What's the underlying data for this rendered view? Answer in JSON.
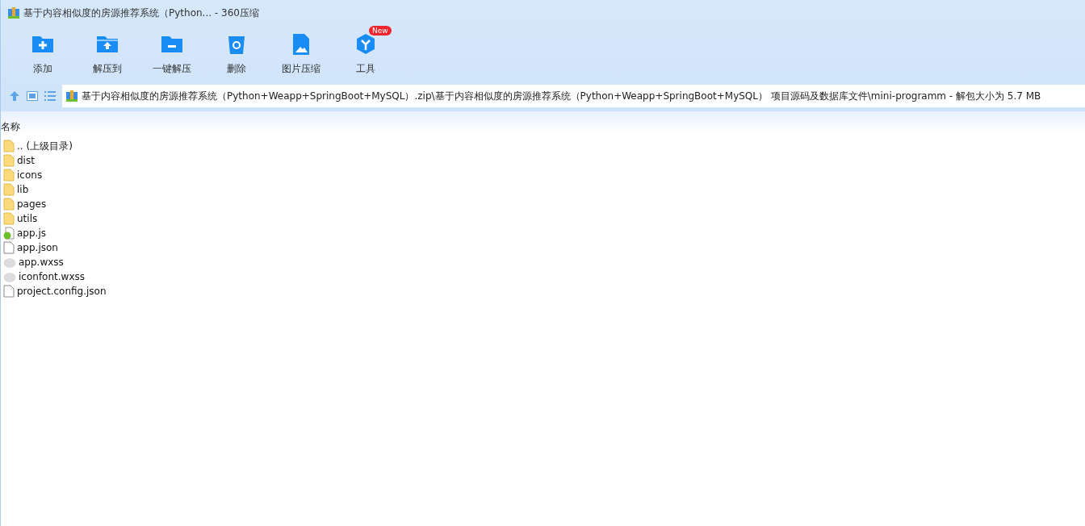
{
  "window": {
    "title": "基于内容相似度的房源推荐系统（Python... - 360压缩"
  },
  "toolbar": [
    {
      "kind": "add",
      "label": "添加"
    },
    {
      "kind": "extract",
      "label": "解压到"
    },
    {
      "kind": "quick",
      "label": "一键解压"
    },
    {
      "kind": "delete",
      "label": "删除"
    },
    {
      "kind": "image",
      "label": "图片压缩"
    },
    {
      "kind": "tools",
      "label": "工具",
      "badge": "New"
    }
  ],
  "address": {
    "path": "基于内容相似度的房源推荐系统（Python+Weapp+SpringBoot+MySQL）.zip\\基于内容相似度的房源推荐系统（Python+Weapp+SpringBoot+MySQL） 项目源码及数据库文件\\mini-programm - 解包大小为 5.7 MB"
  },
  "table": {
    "columns": [
      "名称"
    ],
    "rows": [
      {
        "kind": "parent",
        "name": ".. (上级目录)"
      },
      {
        "kind": "folder",
        "name": "dist"
      },
      {
        "kind": "folder",
        "name": "icons"
      },
      {
        "kind": "folder",
        "name": "lib"
      },
      {
        "kind": "folder",
        "name": "pages"
      },
      {
        "kind": "folder",
        "name": "utils"
      },
      {
        "kind": "script",
        "name": "app.js"
      },
      {
        "kind": "document",
        "name": "app.json"
      },
      {
        "kind": "style",
        "name": "app.wxss"
      },
      {
        "kind": "style",
        "name": "iconfont.wxss"
      },
      {
        "kind": "document",
        "name": "project.config.json"
      }
    ]
  }
}
